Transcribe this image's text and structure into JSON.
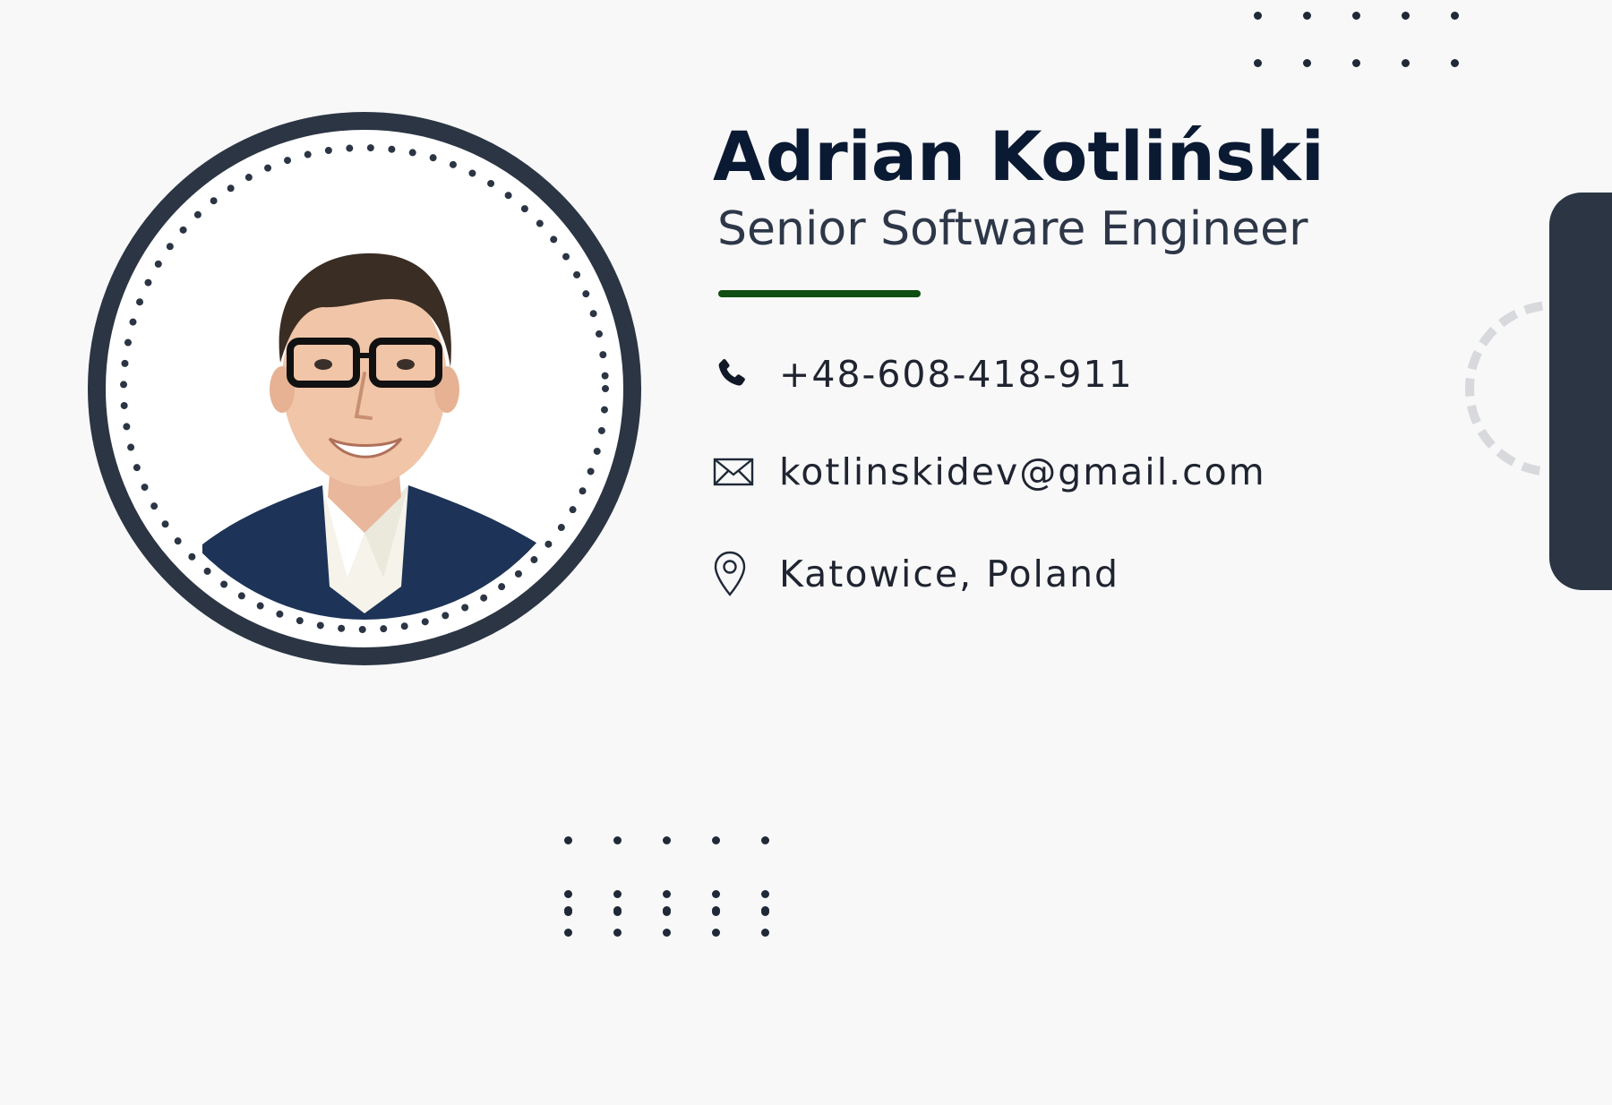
{
  "profile": {
    "name": "Adrian Kotliński",
    "title": "Senior Software Engineer",
    "photo_alt": "portrait-photo"
  },
  "contacts": {
    "phone": {
      "icon": "phone-icon",
      "value": "+48-608-418-911"
    },
    "email": {
      "icon": "envelope-icon",
      "value": "kotlinskidev@gmail.com"
    },
    "location": {
      "icon": "map-pin-icon",
      "value": "Katowice, Poland"
    }
  },
  "colors": {
    "background": "#f8f8f9",
    "primary_dark": "#0b1a33",
    "accent_green": "#0f4e12",
    "frame_dark": "#2b3544"
  }
}
